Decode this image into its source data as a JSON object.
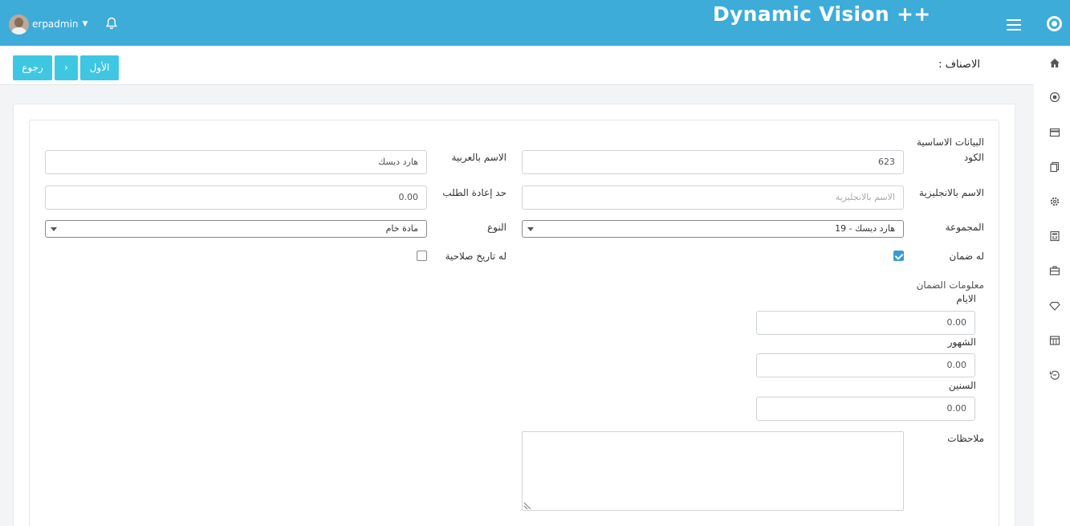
{
  "header": {
    "brand": "Dynamic Vision ++",
    "user_name": "erpadmin",
    "user_caret": "⌄"
  },
  "sidebar": {
    "icons": [
      "home-icon",
      "coin-icon",
      "card-icon",
      "copy-icon",
      "settings-icon",
      "calculator-icon",
      "briefcase-icon",
      "diamond-icon",
      "table-icon",
      "logout-icon"
    ]
  },
  "toolbar": {
    "back_label": "رجوع",
    "next_label": "›",
    "first_label": "الأول",
    "page_title": "الاصناف :"
  },
  "form": {
    "section_title": "البيانات الاساسية",
    "code_label": "الكود",
    "code_value": "623",
    "name_ar_label": "الاسم بالعربية",
    "name_ar_value": "هارد ديسك",
    "name_en_label": "الاسم بالانجليزية",
    "name_en_placeholder": "الاسم بالانجليزية",
    "reorder_label": "حد إعادة الطلب",
    "reorder_value": "0.00",
    "group_label": "المجموعة",
    "group_value": "هارد ديسك - 19",
    "type_label": "النوع",
    "type_value": "مادة خام",
    "warranty_label": "له ضمان",
    "warranty_checked": true,
    "expiry_label": "له تاريخ صلاحية",
    "expiry_checked": false,
    "warranty_info_title": "معلومات الضمان",
    "days_label": "الايام",
    "days_value": "0.00",
    "months_label": "الشهور",
    "months_value": "0.00",
    "years_label": "السنين",
    "years_value": "0.00",
    "notes_label": "ملاحظات",
    "notes_value": ""
  },
  "colors": {
    "header_bg": "#3dacd9",
    "button_bg": "#3ec7e2",
    "checkbox_checked": "#3a9ad5"
  }
}
